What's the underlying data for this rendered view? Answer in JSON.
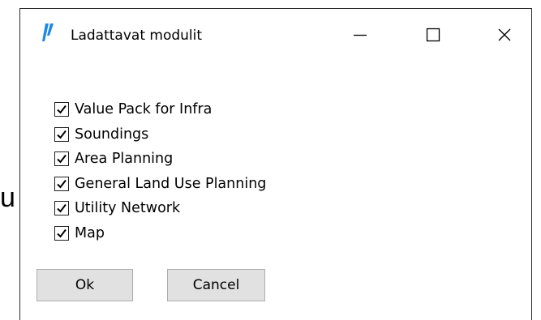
{
  "background": {
    "glyph": "u"
  },
  "window": {
    "title": "Ladattavat modulit",
    "app_icon": "app-logo-icon",
    "controls": {
      "minimize": "minimize-icon",
      "maximize": "maximize-icon",
      "close": "close-icon"
    }
  },
  "modules": [
    {
      "label": "Value Pack for Infra",
      "checked": true
    },
    {
      "label": "Soundings",
      "checked": true
    },
    {
      "label": "Area Planning",
      "checked": true
    },
    {
      "label": "General Land Use Planning",
      "checked": true
    },
    {
      "label": "Utility Network",
      "checked": true
    },
    {
      "label": "Map",
      "checked": true
    }
  ],
  "buttons": {
    "ok": "Ok",
    "cancel": "Cancel"
  },
  "colors": {
    "button_face": "#e1e1e1",
    "button_border": "#adadad",
    "icon_accent": "#1e88e5"
  }
}
